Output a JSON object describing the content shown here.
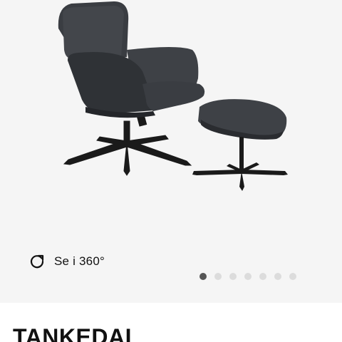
{
  "gallery": {
    "image_alt": "Armchair with footstool",
    "view_360_label": "Se i 360°",
    "view_360_icon": "rotate-icon",
    "dots_total": 7,
    "active_dot": 0
  },
  "product": {
    "title": "TANKEDAL"
  },
  "colors": {
    "gallery_background": "#f5f5f5",
    "upholstery": "#3a3d42",
    "frame": "#1a1a1a",
    "dot_active": "#555555",
    "dot_inactive": "#dcdcdc"
  }
}
